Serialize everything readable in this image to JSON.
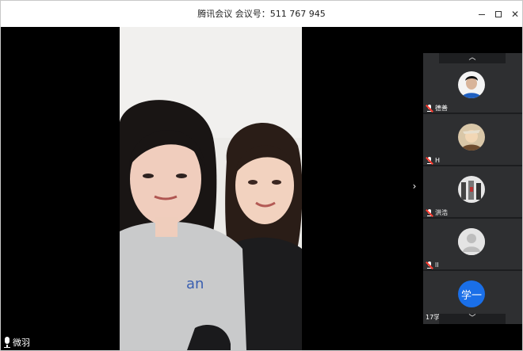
{
  "window": {
    "title": "腾讯会议 会议号：511 767 945"
  },
  "stage": {
    "active_speaker": "微羽",
    "collapse_label": "›"
  },
  "panel": {
    "scroll_up": "︿",
    "scroll_down": "﹀",
    "participants": [
      {
        "name": "德善",
        "avatar": "photo-male-dark",
        "muted": true
      },
      {
        "name": "H",
        "avatar": "photo-cartoon",
        "muted": true
      },
      {
        "name": "洪浩",
        "avatar": "photo-group",
        "muted": true
      },
      {
        "name": "ll",
        "avatar": "default-person",
        "muted": true
      },
      {
        "name": "17学...",
        "avatar_text": "学一",
        "muted": false
      }
    ]
  },
  "colors": {
    "titlebar": "#ffffff",
    "panel_bg": "#2e2f31",
    "avatar_blue": "#1a6fe8",
    "mute_red": "#ff3b30"
  }
}
